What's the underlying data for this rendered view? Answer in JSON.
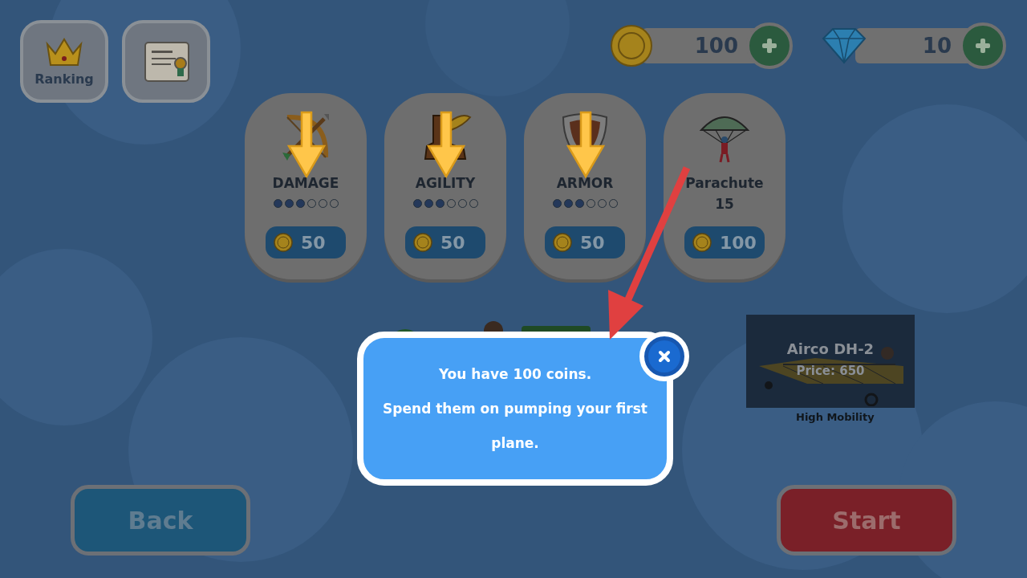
{
  "top_buttons": [
    {
      "kind": "ranking",
      "label": "Ranking"
    },
    {
      "kind": "scroll"
    }
  ],
  "currencies": [
    {
      "kind": "coin",
      "amount": "100"
    },
    {
      "kind": "gem",
      "amount": "10"
    }
  ],
  "upgrades": [
    {
      "kind": "bow",
      "label": "DAMAGE",
      "stars": 3,
      "price": "50",
      "highlighted": true
    },
    {
      "kind": "boot",
      "label": "AGILITY",
      "stars": 3,
      "price": "50",
      "highlighted": true
    },
    {
      "kind": "shield",
      "label": "ARMOR",
      "stars": 3,
      "price": "50",
      "highlighted": true
    },
    {
      "kind": "parachute",
      "label": "Parachute",
      "value": "15",
      "price": "100",
      "highlighted": false
    }
  ],
  "plane": {
    "name": "Airco DH-2",
    "price": "Price: 650",
    "trait": "High Mobility"
  },
  "popup": {
    "pointer": true,
    "lines": [
      "You have 100 coins.",
      "Spend them on pumping your first plane."
    ]
  },
  "buttons": [
    {
      "kind": "back",
      "label": "Back"
    },
    {
      "kind": "start",
      "label": "Start"
    }
  ]
}
